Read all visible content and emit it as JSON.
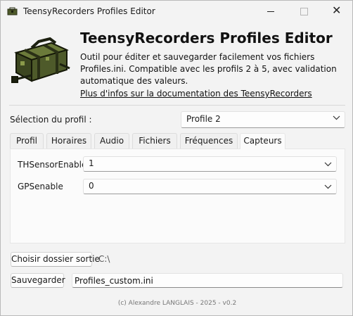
{
  "window": {
    "title": "TeensyRecorders Profiles Editor",
    "icons": {
      "minimize": "minimize-icon",
      "maximize": "maximize-icon",
      "close": "close-icon"
    }
  },
  "header": {
    "title": "TeensyRecorders Profiles Editor",
    "description": "Outil pour éditer et sauvegarder facilement vos fichiers Profiles.ini. Compatible avec les profils 2 à 5, avec validation automatique des valeurs.",
    "doc_link": "Plus d'infos sur la documentation des TeensyRecorders",
    "logo": "recorder-case-logo"
  },
  "profile": {
    "label": "Sélection du profil :",
    "selected": "Profile 2"
  },
  "tabs": [
    {
      "label": "Profil"
    },
    {
      "label": "Horaires"
    },
    {
      "label": "Audio"
    },
    {
      "label": "Fichiers"
    },
    {
      "label": "Fréquences"
    },
    {
      "label": "Capteurs"
    }
  ],
  "active_tab": "Capteurs",
  "sensors": {
    "th": {
      "label": "THSensorEnable",
      "value": "1"
    },
    "gps": {
      "label": "GPSenable",
      "value": "0"
    }
  },
  "output": {
    "choose_folder_label": "Choisir dossier sortie",
    "folder_path": "C:\\",
    "save_label": "Sauvegarder",
    "filename": "Profiles_custom.ini"
  },
  "footer": "(c) Alexandre LANGLAIS - 2025 - v0.2",
  "colors": {
    "background": "#f3f3f3",
    "panel": "#fbfbfb",
    "case_green": "#4e5a2a",
    "case_dark": "#2d3318"
  }
}
